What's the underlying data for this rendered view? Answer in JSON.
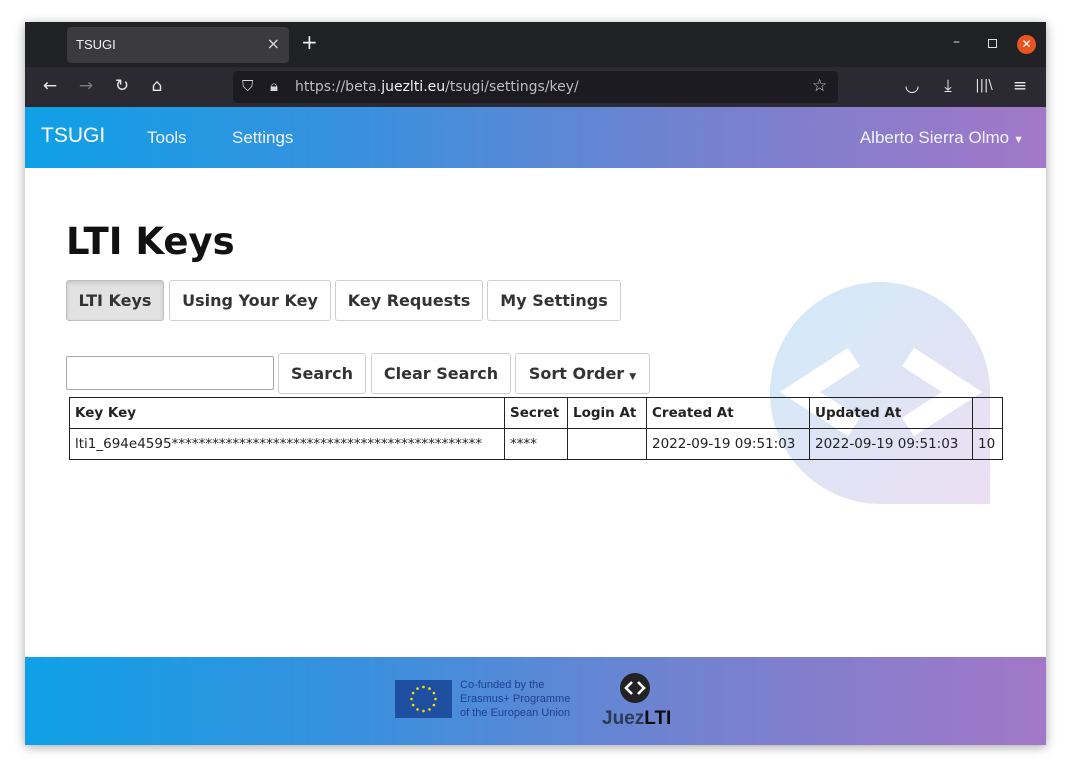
{
  "browser": {
    "tab_title": "TSUGI",
    "tab_close": "×",
    "new_tab": "+",
    "url_prefix": "https://beta.",
    "url_domain": "juezlti.eu",
    "url_path": "/tsugi/settings/key/"
  },
  "site": {
    "brand": "TSUGI",
    "nav": [
      "Tools",
      "Settings"
    ],
    "user": "Alberto Sierra Olmo"
  },
  "page": {
    "title": "LTI Keys",
    "tabs": [
      "LTI Keys",
      "Using Your Key",
      "Key Requests",
      "My Settings"
    ],
    "search_value": "",
    "search_button": "Search",
    "clear_search_button": "Clear Search",
    "sort_order_button": "Sort Order"
  },
  "table": {
    "headers": [
      "Key Key",
      "Secret",
      "Login At",
      "Created At",
      "Updated At",
      ""
    ],
    "rows": [
      [
        "lti1_694e4595**********************************************",
        "****",
        "",
        "2022-09-19 09:51:03",
        "2022-09-19 09:51:03",
        "10"
      ]
    ]
  },
  "footer": {
    "eu_text": [
      "Co-funded by the",
      "Erasmus+ Programme",
      "of the European Union"
    ],
    "logo_part1": "Juez",
    "logo_part2": "LTI"
  },
  "colors": {
    "header_gradient_start": "#0ea0e6",
    "header_gradient_end": "#a377c8",
    "browser_chrome": "#202124",
    "close_button": "#e95420"
  }
}
